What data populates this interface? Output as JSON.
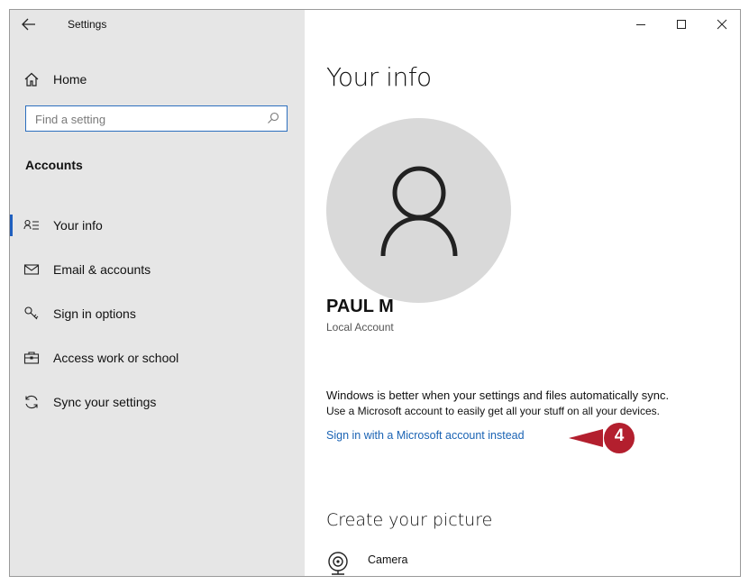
{
  "window": {
    "title": "Settings",
    "controls": {
      "minimize": "minimize-icon",
      "maximize": "maximize-icon",
      "close": "close-icon"
    }
  },
  "sidebar": {
    "home_label": "Home",
    "search": {
      "placeholder": "Find a setting",
      "value": ""
    },
    "section_title": "Accounts",
    "items": [
      {
        "label": "Your info",
        "icon": "person-lines-icon",
        "selected": true
      },
      {
        "label": "Email & accounts",
        "icon": "mail-icon",
        "selected": false
      },
      {
        "label": "Sign in options",
        "icon": "key-icon",
        "selected": false
      },
      {
        "label": "Access work or school",
        "icon": "briefcase-icon",
        "selected": false
      },
      {
        "label": "Sync your settings",
        "icon": "sync-icon",
        "selected": false
      }
    ]
  },
  "main": {
    "page_title": "Your info",
    "user_name": "PAUL M",
    "account_type": "Local Account",
    "sync_message_line1": "Windows is better when your settings and files automatically sync.",
    "sync_message_line2": "Use a Microsoft account to easily get all your stuff on all your devices.",
    "ms_link": "Sign in with a Microsoft account instead",
    "create_picture_title": "Create your picture",
    "camera_label": "Camera"
  },
  "annotation": {
    "step_number": "4",
    "color": "#b31f2e"
  },
  "colors": {
    "sidebar_bg": "#e6e6e6",
    "accent": "#1f5fbf",
    "link": "#1a63b4",
    "avatar_bg": "#d9d9d9"
  }
}
